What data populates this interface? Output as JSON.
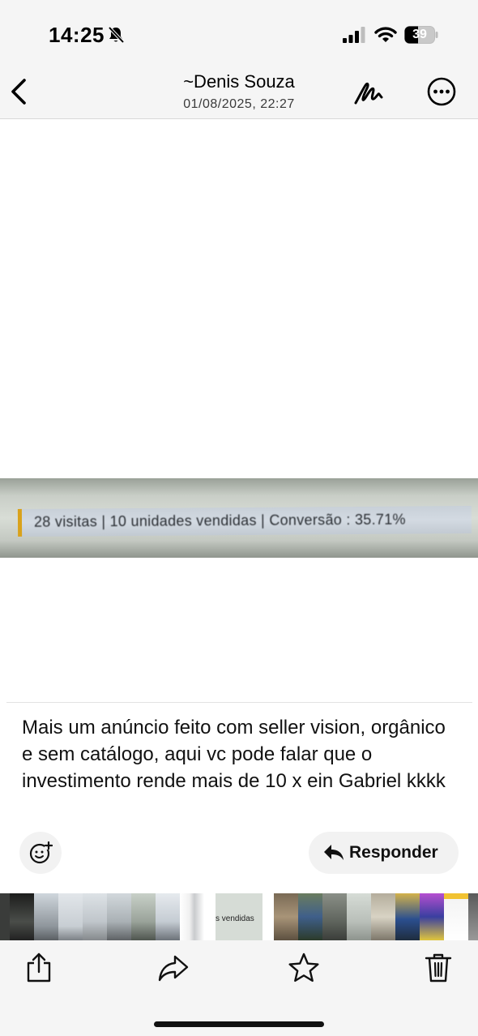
{
  "status_bar": {
    "time": "14:25",
    "battery_level": "39",
    "icons": [
      "bell-slash-icon",
      "signal-icon",
      "wifi-icon",
      "battery-icon"
    ]
  },
  "nav": {
    "contact_name": "~Denis Souza",
    "date": "01/08/2025, 22:27",
    "icons": [
      "back-chevron-icon",
      "markup-icon",
      "more-icon"
    ]
  },
  "photo": {
    "text": "28 visitas | 10 unidades vendidas | Conversão : 35.71%"
  },
  "caption": "Mais um anúncio feito com seller vision, orgânico e sem catálogo, aqui vc pode falar que o investimento rende mais de 10 x ein Gabriel kkkk",
  "actions": {
    "reply_label": "Responder",
    "icons": [
      "add-reaction-icon",
      "reply-arrow-icon"
    ]
  },
  "thumbnails": {
    "selected_text": "s vendidas"
  },
  "toolbar": {
    "icons": [
      "share-icon",
      "forward-icon",
      "star-icon",
      "trash-icon"
    ]
  },
  "colors": {
    "background": "#ffffff",
    "bar_background": "#f5f5f5",
    "photo_accent": "#d9a21b"
  }
}
